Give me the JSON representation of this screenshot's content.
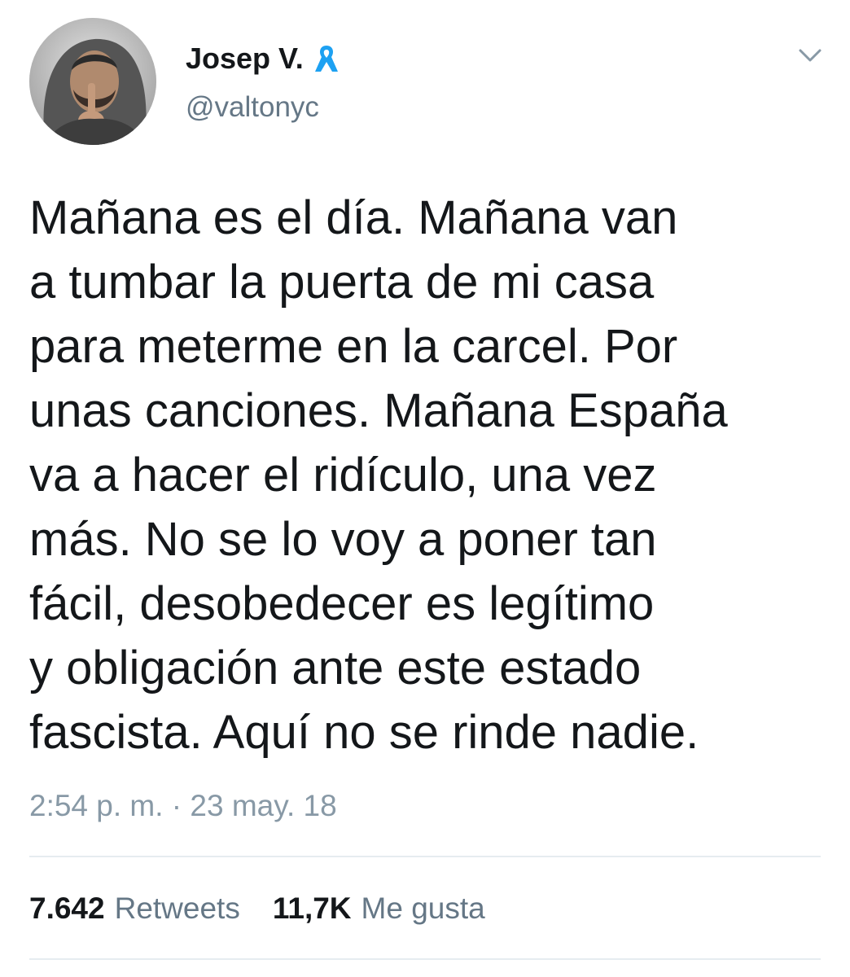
{
  "user": {
    "display_name": "Josep V.",
    "handle": "@valtonyc",
    "badge_icon": "blue-ribbon-icon",
    "badge_color": "#1da1f2"
  },
  "tweet": {
    "text": "Mañana es el día. Mañana van\na tumbar la puerta de mi casa\npara meterme en la carcel. Por\nunas canciones. Mañana España\nva a hacer el ridículo, una vez\nmás. No se lo voy a poner tan\nfácil, desobedecer es legítimo\ny obligación ante este estado\nfascista. Aquí no se rinde nadie.",
    "timestamp": "2:54 p. m. · 23 may. 18"
  },
  "stats": {
    "retweets_count": "7.642",
    "retweets_label": "Retweets",
    "likes_count": "11,7K",
    "likes_label": "Me gusta"
  },
  "colors": {
    "text": "#14171a",
    "secondary": "#657786",
    "timestamp": "#8899a6",
    "divider": "#e6ecf0"
  },
  "icons": {
    "menu": "chevron-down-icon"
  }
}
